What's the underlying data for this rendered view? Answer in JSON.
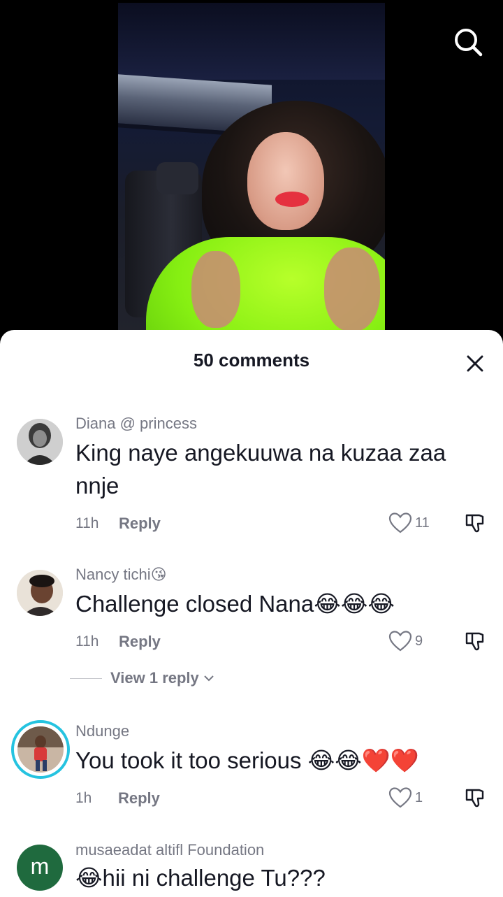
{
  "header": {
    "search_icon": "search-icon"
  },
  "sheet": {
    "title": "50 comments",
    "close_icon": "close-icon"
  },
  "comments": [
    {
      "username": "Diana @ princess",
      "text": "King naye angekuuwa na kuzaa zaa nnje",
      "time": "11h",
      "reply_label": "Reply",
      "likes": "11"
    },
    {
      "username": "Nancy tichi😘",
      "text": "Challenge closed Nana😂😂😂",
      "time": "11h",
      "reply_label": "Reply",
      "likes": "9",
      "view_replies": "View 1 reply"
    },
    {
      "username": "Ndunge",
      "text": "You took it too serious 😂😂❤️❤️",
      "time": "1h",
      "reply_label": "Reply",
      "likes": "1"
    },
    {
      "username": "musaeadat altifl Foundation",
      "text": "😂hii ni challenge Tu???",
      "avatar_letter": "m"
    }
  ],
  "colors": {
    "accent_text": "#161823",
    "secondary_text": "#757783",
    "avatar_m": "#1f6a3e",
    "story_ring": "#25c3e0"
  }
}
